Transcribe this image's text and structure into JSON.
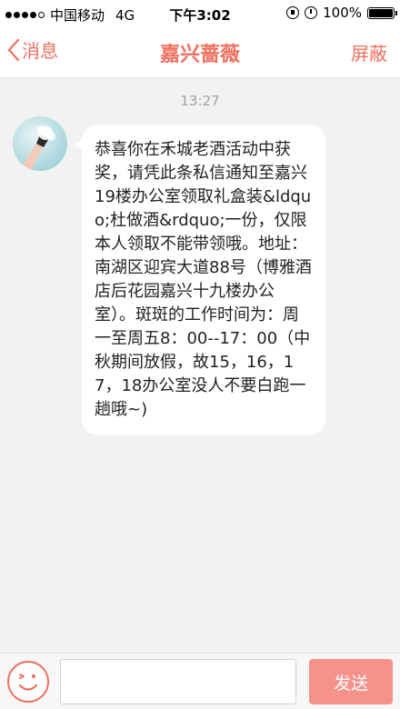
{
  "status_bar": {
    "carrier": "中国移动",
    "network": "4G",
    "time": "下午3:02",
    "battery": "100%"
  },
  "nav": {
    "back_label": "消息",
    "title": "嘉兴蔷薇",
    "block_label": "屏蔽"
  },
  "chat": {
    "timestamp": "13:27",
    "message": "恭喜你在禾城老酒活动中获奖，请凭此条私信通知至嘉兴19楼办公室领取礼盒装&ldquo;杜做酒&rdquo;一份，仅限本人领取不能带领哦。地址：南湖区迎宾大道88号（博雅酒店后花园嘉兴十九楼办公室）。斑斑的工作时间为：周一至周五8：00--17：00（中秋期间放假，故15，16，17，18办公室没人不要白跑一趟哦~)"
  },
  "input_bar": {
    "placeholder": "",
    "send_label": "发送"
  },
  "colors": {
    "accent": "#f0705f",
    "send_button": "#f6928a",
    "background": "#f2f2f2"
  }
}
